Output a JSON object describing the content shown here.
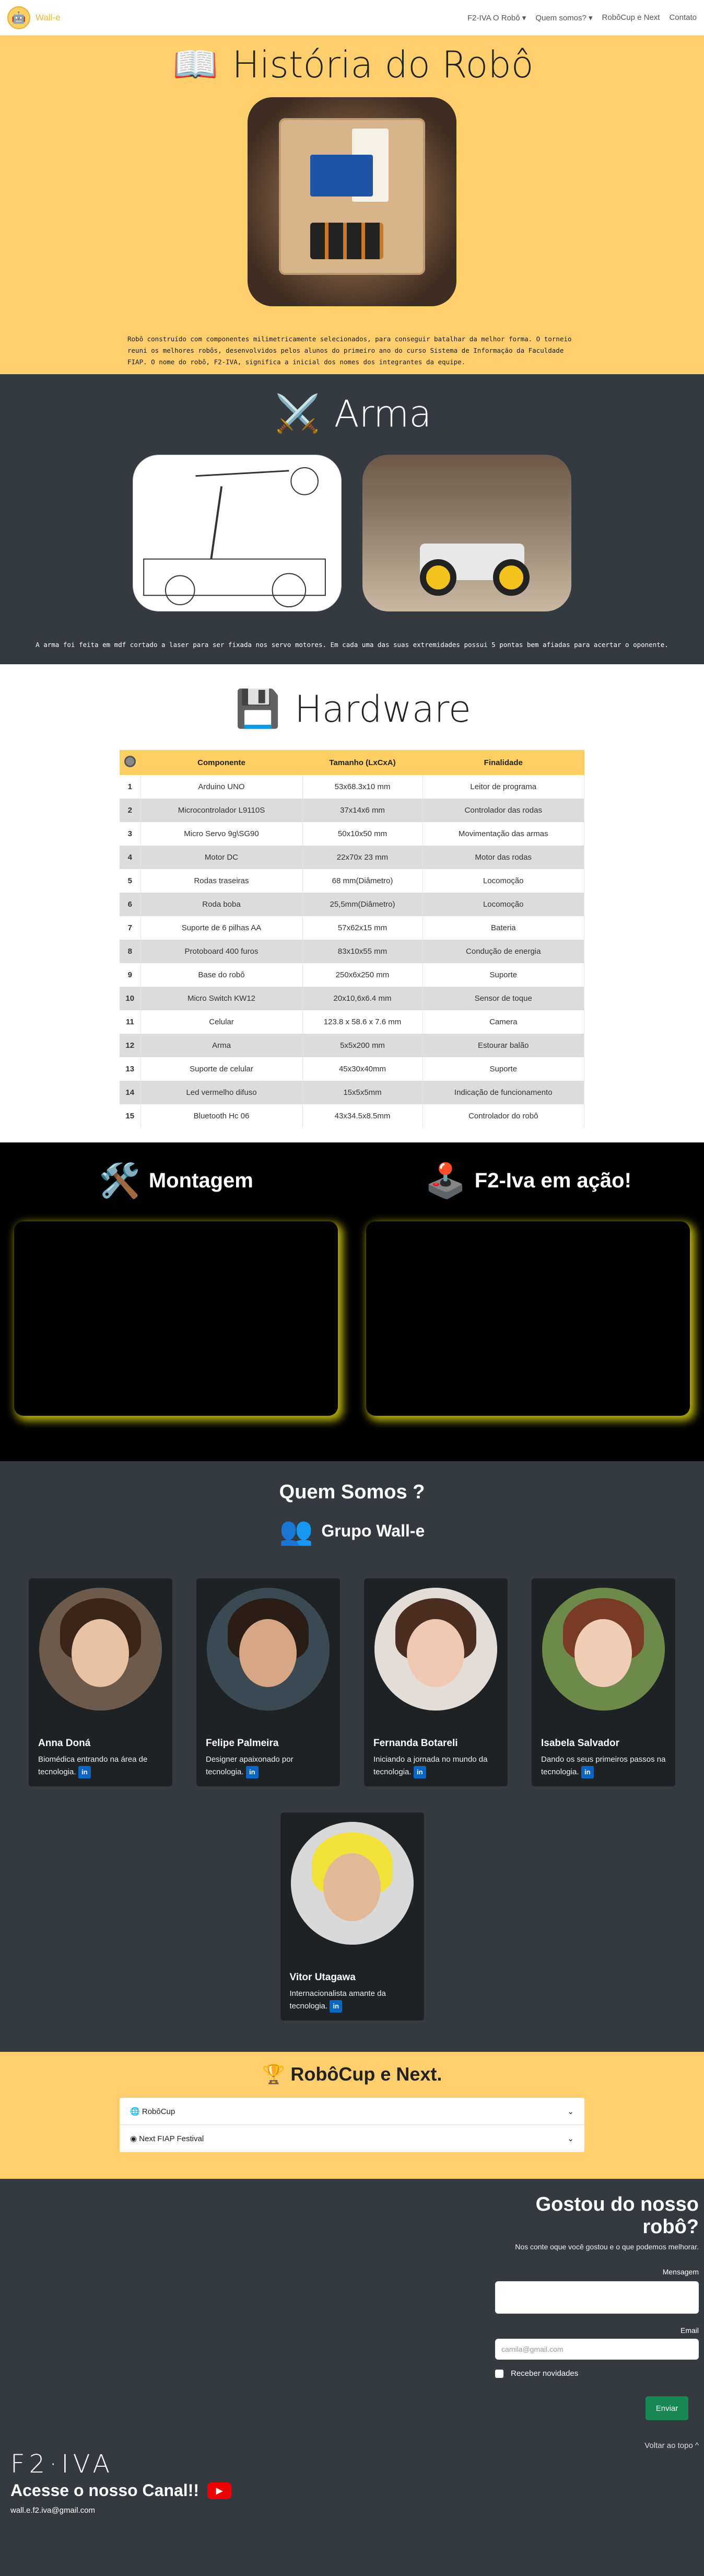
{
  "nav": {
    "brand": "Wall-e",
    "links": [
      "F2-IVA O Robô ▾",
      "Quem somos? ▾",
      "RobôCup e Next",
      "Contato"
    ]
  },
  "history": {
    "title": "História do Robô",
    "text": "Robô construído com componentes milimetricamente selecionados, para conseguir batalhar da melhor forma. O torneio reuni os melhores robôs, desenvolvidos pelos alunos do primeiro ano do curso Sistema de Informação da Faculdade FIAP. O nome do robô, F2-IVA, significa a inicial dos nomes dos integrantes da equipe."
  },
  "arma": {
    "title": "Arma",
    "text": "A arma foi feita em mdf cortado a laser para ser fixada nos servo motores. Em cada uma das suas extremidades possui 5 pontas bem afiadas para acertar o oponente."
  },
  "hardware": {
    "title": "Hardware",
    "headers": [
      "Componente",
      "Tamanho (LxCxA)",
      "Finalidade"
    ],
    "rows": [
      [
        "1",
        "Arduino UNO",
        "53x68.3x10 mm",
        "Leitor de programa"
      ],
      [
        "2",
        "Microcontrolador L9110S",
        "37x14x6 mm",
        "Controlador das rodas"
      ],
      [
        "3",
        "Micro Servo 9g\\SG90",
        "50x10x50 mm",
        "Movimentação das armas"
      ],
      [
        "4",
        "Motor DC",
        "22x70x 23 mm",
        "Motor das rodas"
      ],
      [
        "5",
        "Rodas traseiras",
        "68 mm(Diâmetro)",
        "Locomoção"
      ],
      [
        "6",
        "Roda boba",
        "25,5mm(Diâmetro)",
        "Locomoção"
      ],
      [
        "7",
        "Suporte de 6 pilhas AA",
        "57x62x15 mm",
        "Bateria"
      ],
      [
        "8",
        "Protoboard 400 furos",
        "83x10x55 mm",
        "Condução de energia"
      ],
      [
        "9",
        "Base do robô",
        "250x6x250 mm",
        "Suporte"
      ],
      [
        "10",
        "Micro Switch KW12",
        "20x10,6x6.4 mm",
        "Sensor de toque"
      ],
      [
        "11",
        "Celular",
        "123.8 x 58.6 x 7.6 mm",
        "Camera"
      ],
      [
        "12",
        "Arma",
        "5x5x200 mm",
        "Estourar balão"
      ],
      [
        "13",
        "Suporte de celular",
        "45x30x40mm",
        "Suporte"
      ],
      [
        "14",
        "Led vermelho difuso",
        "15x5x5mm",
        "Indicação de funcionamento"
      ],
      [
        "15",
        "Bluetooth Hc 06",
        "43x34.5x8.5mm",
        "Controlador do robô"
      ]
    ]
  },
  "montagem": {
    "title_left": "Montagem",
    "title_right": "F2-Iva em ação!"
  },
  "team": {
    "title": "Quem Somos ?",
    "subtitle": "Grupo Wall-e",
    "members": [
      {
        "name": "Anna Doná",
        "desc": "Biomédica entrando na área de tecnologia."
      },
      {
        "name": "Felipe Palmeira",
        "desc": "Designer apaixonado por tecnologia."
      },
      {
        "name": "Fernanda Botareli",
        "desc": "Iniciando a jornada no mundo da tecnologia."
      },
      {
        "name": "Isabela Salvador",
        "desc": "Dando os seus primeiros passos na tecnologia."
      },
      {
        "name": "Vitor Utagawa",
        "desc": "Internacionalista amante da tecnologia."
      }
    ]
  },
  "robocup": {
    "title": "RobôCup e Next.",
    "items": [
      "RobôCup",
      "Next FIAP Festival"
    ]
  },
  "contact": {
    "title": "Gostou do nosso robô?",
    "subtitle": "Nos conte oque você gostou e o que podemos melhorar.",
    "message_label": "Mensagem",
    "email_label": "Email",
    "email_placeholder": "camila@gmail.com",
    "checkbox_label": "Receber novidades",
    "send": "Enviar",
    "back_top": "Voltar ao topo ^"
  },
  "footer": {
    "logo": "F2·IVA",
    "channel": "Acesse o nosso Canal!!",
    "email": "wall.e.f2.iva@gmail.com"
  },
  "colors": {
    "accent": "#fecf6c",
    "dark": "#343a40",
    "glow": "#b8b10a"
  }
}
